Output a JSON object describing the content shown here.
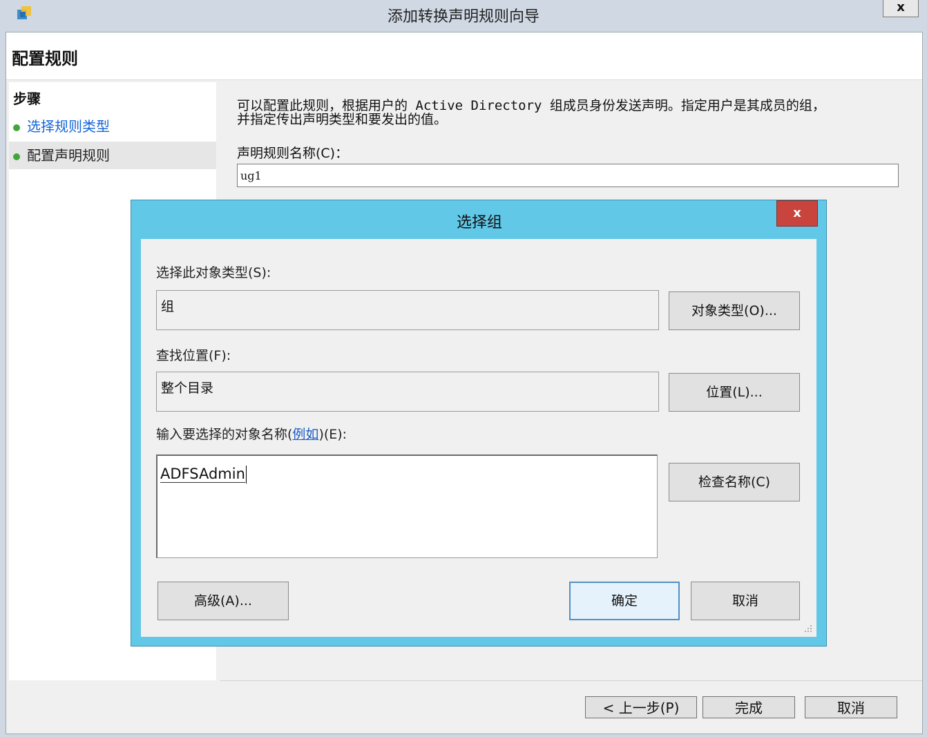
{
  "window": {
    "title": "添加转换声明规则向导",
    "close_label": "x"
  },
  "header": {
    "title": "配置规则"
  },
  "steps": {
    "title": "步骤",
    "items": [
      {
        "label": "选择规则类型",
        "active": false
      },
      {
        "label": "配置声明规则",
        "active": true
      }
    ]
  },
  "main": {
    "description_line1": "可以配置此规则，根据用户的 Active Directory 组成员身份发送声明。指定用户是其成员的组，",
    "description_line2": "并指定传出声明类型和要发出的值。",
    "rule_name_label": "声明规则名称(C)：",
    "rule_name_value": "ug1"
  },
  "footer": {
    "back_label": "< 上一步(P)",
    "finish_label": "完成",
    "cancel_label": "取消"
  },
  "dialog": {
    "title": "选择组",
    "close_label": "x",
    "object_type_label": "选择此对象类型(S):",
    "object_type_value": "组",
    "object_type_button": "对象类型(O)...",
    "location_label": "查找位置(F):",
    "location_value": "整个目录",
    "location_button": "位置(L)...",
    "names_label_prefix": "输入要选择的对象名称(",
    "names_label_link": "例如",
    "names_label_suffix": ")(E):",
    "names_value": "ADFSAdmin",
    "check_names_button": "检查名称(C)",
    "advanced_button": "高级(A)...",
    "ok_button": "确定",
    "cancel_button": "取消"
  },
  "colors": {
    "dialog_frame": "#62c8e8",
    "close_red": "#c9443d",
    "link_blue": "#1a5cc7",
    "step_dot": "#41a63a"
  }
}
